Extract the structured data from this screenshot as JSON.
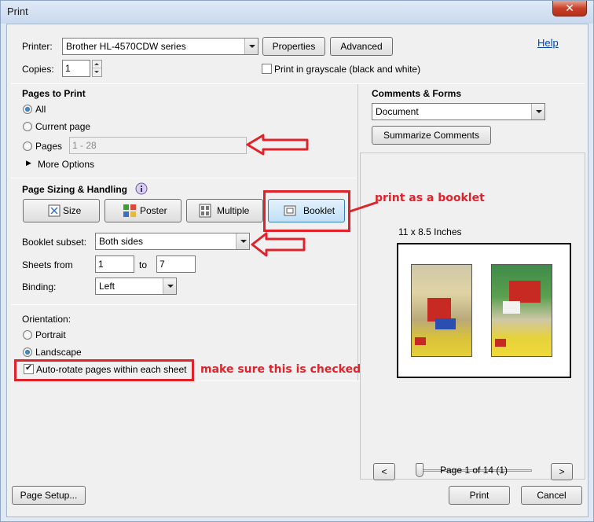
{
  "window": {
    "title": "Print",
    "close": "✕"
  },
  "printer": {
    "label": "Printer:",
    "value": "Brother HL-4570CDW series",
    "properties": "Properties",
    "advanced": "Advanced",
    "help": "Help"
  },
  "copies": {
    "label": "Copies:",
    "value": "1",
    "grayscale": "Print in grayscale (black and white)",
    "grayscale_checked": false
  },
  "pages_to_print": {
    "title": "Pages to Print",
    "all": "All",
    "current": "Current page",
    "pages": "Pages",
    "pages_value": "1 - 28",
    "more_options": "More Options",
    "selected": "all"
  },
  "sizing": {
    "title": "Page Sizing & Handling",
    "size": "Size",
    "poster": "Poster",
    "multiple": "Multiple",
    "booklet": "Booklet",
    "selected": "booklet"
  },
  "booklet": {
    "subset_label": "Booklet subset:",
    "subset_value": "Both sides",
    "sheets_label": "Sheets from",
    "sheets_from": "1",
    "to_label": "to",
    "sheets_to": "7",
    "binding_label": "Binding:",
    "binding_value": "Left"
  },
  "orientation": {
    "title": "Orientation:",
    "portrait": "Portrait",
    "landscape": "Landscape",
    "selected": "landscape",
    "auto_rotate": "Auto-rotate pages within each sheet",
    "auto_rotate_checked": true
  },
  "comments_forms": {
    "title": "Comments & Forms",
    "value": "Document",
    "summarize": "Summarize Comments"
  },
  "preview": {
    "size_label": "11 x 8.5 Inches",
    "page_label": "Page 1 of 14 (1)",
    "prev": "<",
    "next": ">"
  },
  "footer": {
    "page_setup": "Page Setup...",
    "print": "Print",
    "cancel": "Cancel"
  },
  "annotations": {
    "booklet_note": "print as a booklet",
    "autorotate_note": "make sure this is checked",
    "color": "#e0232b"
  }
}
